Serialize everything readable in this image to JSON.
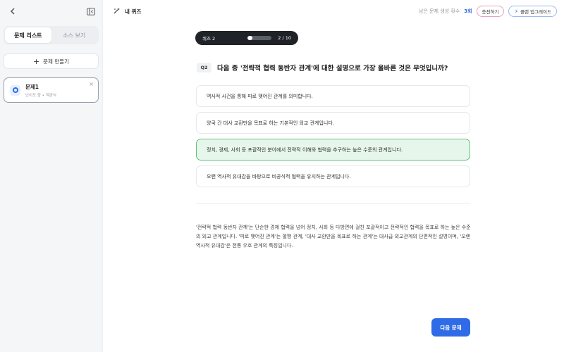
{
  "sidebar": {
    "tabs": [
      {
        "label": "문제 리스트",
        "active": true
      },
      {
        "label": "소스 보기",
        "active": false
      }
    ],
    "create_label": "문제 만들기",
    "question_card": {
      "title": "문제1",
      "subtitle": "난이도 중 • 객관식"
    }
  },
  "header": {
    "title": "내 퀴즈",
    "remaining_label": "남은 문제 생성 횟수",
    "remaining_count": "3회",
    "charge_label": "충전하기",
    "upgrade_label": "플랜 업그레이드"
  },
  "quiz": {
    "label": "퀴즈 2",
    "progress_fraction": 0.2,
    "progress_text": "2 / 10",
    "question_badge": "Q2",
    "question_text": "다음 중 '전략적 협력 동반자 관계'에 대한 설명으로 가장 올바른 것은 무엇입니까?",
    "options": [
      {
        "text": "역사적 사건을 통해 피로 맺어진 관계를 의미합니다.",
        "correct": false
      },
      {
        "text": "양국 간 대사 교환만을 목표로 하는 기본적인 외교 관계입니다.",
        "correct": false
      },
      {
        "text": "정치, 경제, 사회 등 포괄적인 분야에서 전략적 이해와 협력을 추구하는 높은 수준의 관계입니다.",
        "correct": true
      },
      {
        "text": "오랜 역사적 유대감을 바탕으로 비공식적 협력을 유지하는 관계입니다.",
        "correct": false
      }
    ],
    "explanation": "'전략적 협력 동반자 관계'는 단순한 경제 협력을 넘어 정치, 사회 등 다방면에 걸친 포괄적이고 전략적인 협력을 목표로 하는 높은 수준의 외교 관계입니다. '피로 맺어진 관계'는 혈맹 관계, '대사 교환만을 목표로 하는 관계'는 대사급 외교관계의 단편적인 설명이며, '오랜 역사적 유대감'은 전통 우호 관계의 특징입니다.",
    "next_label": "다음 문제"
  },
  "colors": {
    "accent": "#2f6be6",
    "correct_bg": "#e6f6ea",
    "correct_border": "#5fc27a"
  }
}
